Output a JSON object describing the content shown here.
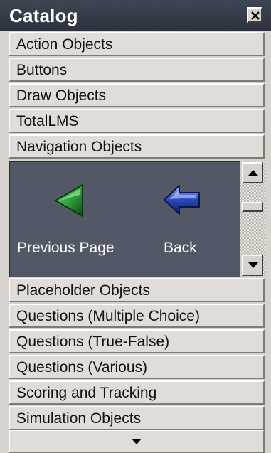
{
  "panel": {
    "title": "Catalog",
    "close_icon": "close-x-icon"
  },
  "categories_top": [
    {
      "label": "Action Objects"
    },
    {
      "label": "Buttons"
    },
    {
      "label": "Draw Objects"
    },
    {
      "label": "TotalLMS"
    },
    {
      "label": "Navigation Objects"
    }
  ],
  "navigation_objects": [
    {
      "label": "Previous Page",
      "icon": "green-left-arrow-icon",
      "color": "#2e9a3a"
    },
    {
      "label": "Back",
      "icon": "blue-back-arrow-icon",
      "color": "#2a48b8"
    }
  ],
  "categories_bottom": [
    {
      "label": "Placeholder Objects"
    },
    {
      "label": "Questions (Multiple Choice)"
    },
    {
      "label": "Questions (True-False)"
    },
    {
      "label": "Questions (Various)"
    },
    {
      "label": "Scoring and Tracking"
    },
    {
      "label": "Simulation Objects"
    }
  ],
  "scroll_more_icon": "down-triangle-icon",
  "colors": {
    "title_bar": "#353b47",
    "object_area": "#535866",
    "button_face": "#e1dcd8"
  }
}
